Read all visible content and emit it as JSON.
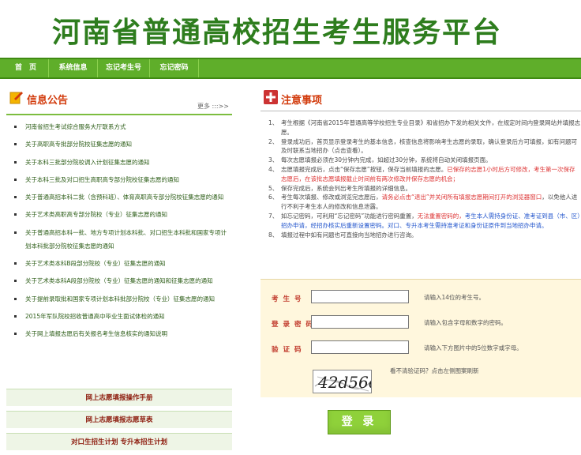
{
  "header": {
    "title": "河南省普通高校招生考生服务平台"
  },
  "nav": {
    "items": [
      "首　页",
      "系统信息",
      "忘记考生号",
      "忘记密码"
    ]
  },
  "notices": {
    "title": "信息公告",
    "more": "更多 :::>>",
    "items": [
      "河南省招生考试综合服务大厅联系方式",
      "关于高职高专批部分院校征集志愿的通知",
      "关于本科三批部分院校调入计划征集志愿的通知",
      "关于本科三批及对口招生高职高专部分院校征集志愿的通知",
      "关于普通高招本科二批（含预科班）、体育高职高专部分院校征集志愿的通知",
      "关于艺术类高职高专部分院校（专业）征集志愿的通知",
      "关于普通高招本科一批、地方专项计划本科批、对口招生本科批和国家专项计划本科批部分院校征集志愿的通知",
      "关于艺术类本科B段部分院校（专业）征集志愿的通知",
      "关于艺术类本科A段部分院校（专业）征集志愿的通知和征集志愿的通知",
      "关于提前录取批和国家专项计划本科批部分院校（专业）征集志愿的通知",
      "2015年军队院校招收普通高中毕业生面试体检的通知",
      "关于网上填报志愿后有关报名考生信息核实的通知说明"
    ]
  },
  "links": [
    "网上志愿填报操作手册",
    "网上志愿填报志愿草表",
    "对口生招生计划 专升本招生计划"
  ],
  "rules": {
    "title": "注意事项",
    "items": [
      {
        "parts": [
          {
            "t": "考生根据《河南省2015年普通高等学校招生专业目录》和省招办下发的相关文件，在规定时间内登录网站并填报志愿。",
            "c": ""
          }
        ]
      },
      {
        "parts": [
          {
            "t": "登录成功后，首页显示登录考生的基本信息，核查信息将影响考生志愿的录取，确认登录后方可填报，如有问题可及时联系当地招办（点击查看）。",
            "c": ""
          }
        ]
      },
      {
        "parts": [
          {
            "t": "每次志愿填报必须在30分钟内完成，如超过30分钟，系统将自动关闭填报页面。",
            "c": ""
          }
        ]
      },
      {
        "parts": [
          {
            "t": "志愿填报完成后，点击“保存志愿”按钮，保存当前填报的志愿。",
            "c": ""
          },
          {
            "t": "已保存的志愿1小时后方可修改，考生第一次保存志愿后，在该批志愿填报截止时间前有两次修改并保存志愿的机会；",
            "c": "hl"
          }
        ]
      },
      {
        "parts": [
          {
            "t": "保存完成后，系统会列出考生所填报的详细信息。",
            "c": ""
          }
        ]
      },
      {
        "parts": [
          {
            "t": "考生每次填报、修改或浏览完志愿后，",
            "c": ""
          },
          {
            "t": "请务必点击“退出”并关闭所有填报志愿期间打开的浏览器窗口",
            "c": "hl"
          },
          {
            "t": "，以免他人进行不利于考生本人的修改和信息泄露。",
            "c": ""
          }
        ]
      },
      {
        "parts": [
          {
            "t": "如忘记密码，可利用“忘记密码”功能进行密码重置，",
            "c": ""
          },
          {
            "t": "无法重置密码的，",
            "c": "hl"
          },
          {
            "t": "考生本人需持身份证、准考证到县（市、区）招办申请，经招办核实后重新设置密码。对口、专升本考生需持准考证和身份证原件到当地招办申请。",
            "c": "lnk"
          }
        ]
      },
      {
        "parts": [
          {
            "t": "填报过程中如有问题也可直接向当地招办进行咨询。",
            "c": ""
          }
        ]
      }
    ]
  },
  "form": {
    "student_label": "考生号",
    "password_label": "登录密码",
    "code_label": "验证码",
    "student_value": "",
    "password_value": "",
    "code_value": "",
    "student_hint": "请输入14位的考生号。",
    "password_hint": "请输入包含字母和数字的密码。",
    "code_hint": "请输入下方图片中的5位数字或字母。",
    "captcha_text": "42d56c",
    "captcha_hint": "看不清验证码？点击左侧图案刷新",
    "login_label": "登 录"
  },
  "colors": {
    "brand_green": "#2e7d1e",
    "nav_green": "#5fae2a",
    "accent_red": "#d23b0c",
    "form_bg": "#fff7dd"
  }
}
